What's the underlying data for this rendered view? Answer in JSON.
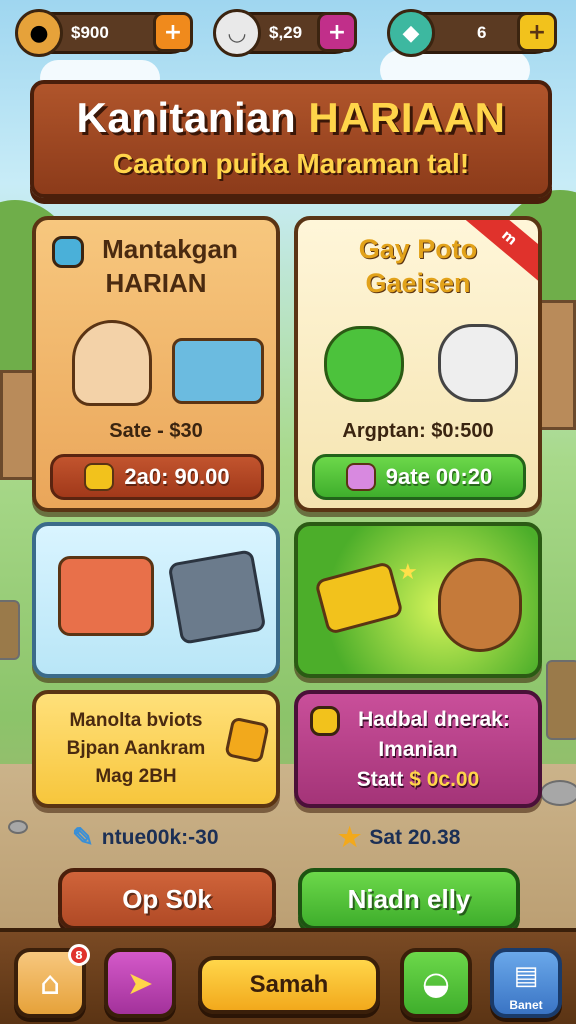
{
  "resources": [
    {
      "name": "cookies",
      "icon": "cookie-icon",
      "value": "$900",
      "action": "+"
    },
    {
      "name": "gems",
      "icon": "bowl-icon",
      "value": "$,29",
      "action": "+"
    },
    {
      "name": "energy",
      "icon": "gem-icon",
      "value": "6",
      "action": "+"
    }
  ],
  "banner": {
    "title_main": "Kanitanian",
    "title_highlight": "HARIAAN",
    "subtitle": "Caaton puika Maraman tal!"
  },
  "cards": {
    "daily_task": {
      "title_line1": "Mantakgan",
      "title_line2": "HARIAN",
      "meta": "Sate - $30",
      "button_label": "2a0: 90.00"
    },
    "pets": {
      "ribbon": "m",
      "title_line1": "Gay Poto",
      "title_line2": "Gaeisen",
      "meta": "Argptan: $0:500",
      "button_label": "9ate 00:20"
    },
    "crafting": {},
    "puppy": {},
    "quest": {
      "line1": "Manolta bviots",
      "line2": "Bjpan Aankram",
      "line3": "Mag 2BH"
    },
    "bonus": {
      "line1": "Hadbal dnerak:",
      "line2": "Imanian",
      "line3_prefix": "Statt",
      "line3_value": "$ 0c.00"
    }
  },
  "stats": {
    "left": {
      "icon": "pen-icon",
      "text": "ntue00k:-30"
    },
    "right": {
      "icon": "star-icon",
      "text": "Sat 20.38"
    }
  },
  "actions": {
    "left_label": "Op S0k",
    "right_label": "Niadn elly"
  },
  "nav": {
    "home_badge": "8",
    "main_label": "Samah",
    "menu_label": "Banet"
  },
  "colors": {
    "brand_brown": "#8c3b1a",
    "accent_yellow": "#ffd54a",
    "green": "#3fae2c",
    "red_brown": "#b5462a",
    "purple": "#b23a86"
  }
}
